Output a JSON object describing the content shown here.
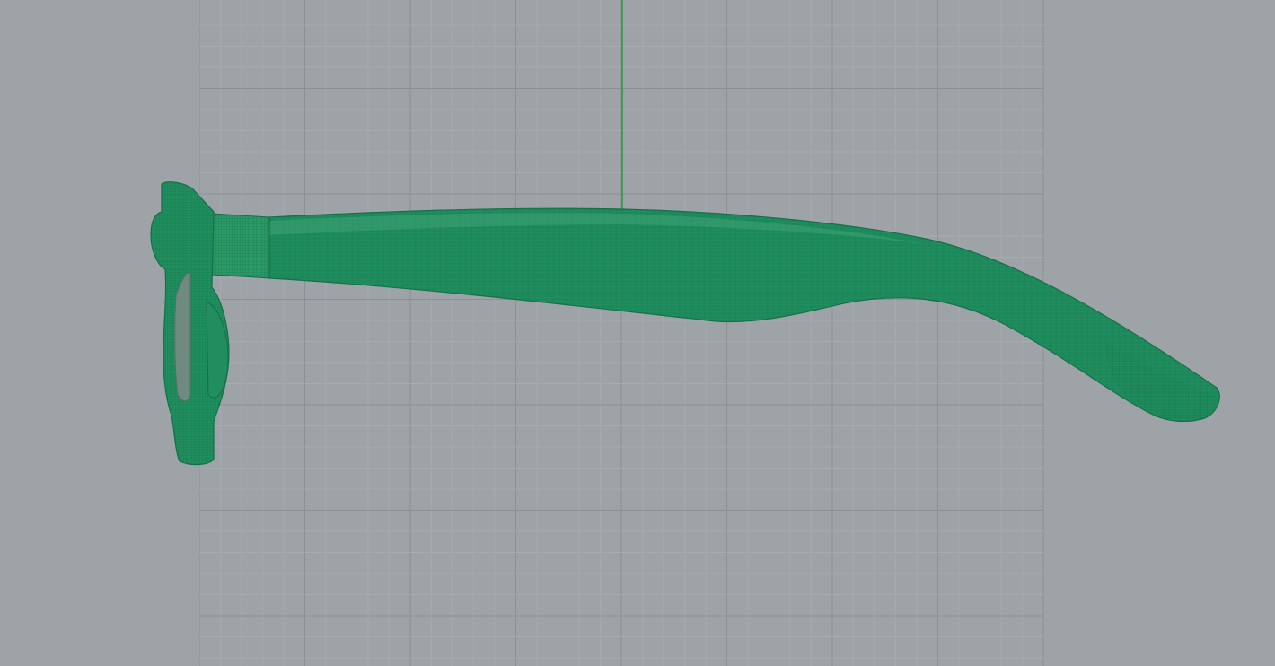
{
  "viewport": {
    "projection": "orthographic",
    "view": "side",
    "display_mode": "wireframe-shaded",
    "background_color": "#9ea3a8",
    "grid_color_minor": "#a9aeb3",
    "grid_color_major": "#8c9196",
    "axis_color_green": "#1e9e3a"
  },
  "model": {
    "name": "eyeglasses-frame",
    "parts": [
      "front-frame",
      "lens",
      "hinge",
      "temple-arm"
    ],
    "mesh_color": "#1f8f5f",
    "wire_color": "#17704a"
  }
}
